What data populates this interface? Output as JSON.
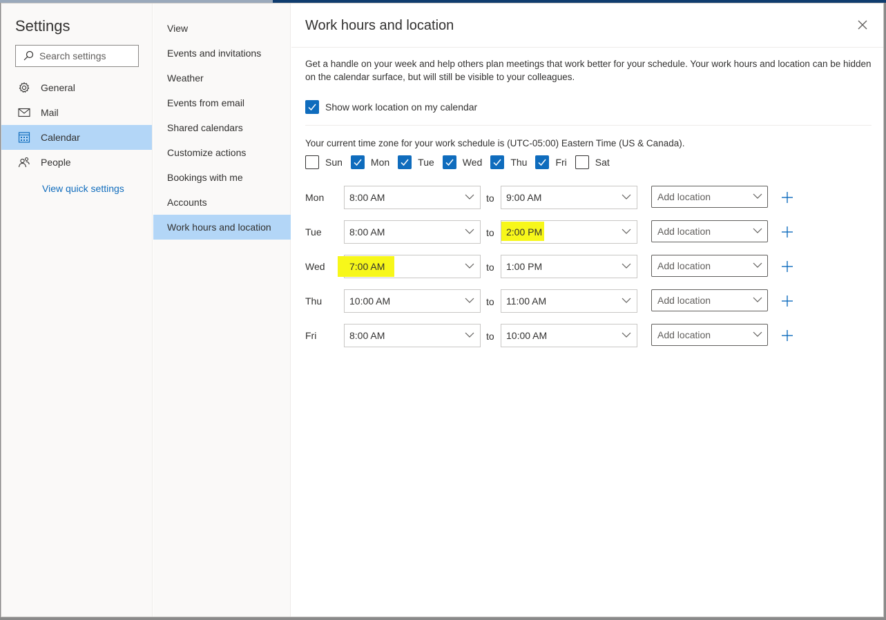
{
  "settings_title": "Settings",
  "search": {
    "placeholder": "Search settings"
  },
  "nav": [
    {
      "label": "General",
      "icon": "gear-icon"
    },
    {
      "label": "Mail",
      "icon": "mail-icon"
    },
    {
      "label": "Calendar",
      "icon": "calendar-icon",
      "selected": true
    },
    {
      "label": "People",
      "icon": "people-icon"
    }
  ],
  "quick_settings": "View quick settings",
  "subnav": [
    "View",
    "Events and invitations",
    "Weather",
    "Events from email",
    "Shared calendars",
    "Customize actions",
    "Bookings with me",
    "Accounts",
    "Work hours and location"
  ],
  "main": {
    "title": "Work hours and location",
    "description": "Get a handle on your week and help others plan meetings that work better for your schedule. Your work hours and location can be hidden on the calendar surface, but will still be visible to your colleagues.",
    "show_location_label": "Show work location on my calendar",
    "show_location_checked": true,
    "timezone_text": "Your current time zone for your work schedule is (UTC-05:00) Eastern Time (US & Canada).",
    "days": [
      {
        "label": "Sun",
        "checked": false
      },
      {
        "label": "Mon",
        "checked": true
      },
      {
        "label": "Tue",
        "checked": true
      },
      {
        "label": "Wed",
        "checked": true
      },
      {
        "label": "Thu",
        "checked": true
      },
      {
        "label": "Fri",
        "checked": true
      },
      {
        "label": "Sat",
        "checked": false
      }
    ],
    "to_label": "to",
    "location_placeholder": "Add location",
    "schedule": [
      {
        "day": "Mon",
        "start": "8:00 AM",
        "end": "9:00 AM"
      },
      {
        "day": "Tue",
        "start": "8:00 AM",
        "end": "2:00 PM"
      },
      {
        "day": "Wed",
        "start": "7:00 AM",
        "end": "1:00 PM"
      },
      {
        "day": "Thu",
        "start": "10:00 AM",
        "end": "11:00 AM"
      },
      {
        "day": "Fri",
        "start": "8:00 AM",
        "end": "10:00 AM"
      }
    ]
  },
  "colors": {
    "accent": "#0f6cbd",
    "selected_bg": "#b3d6f7",
    "highlight": "#f7f71a"
  }
}
